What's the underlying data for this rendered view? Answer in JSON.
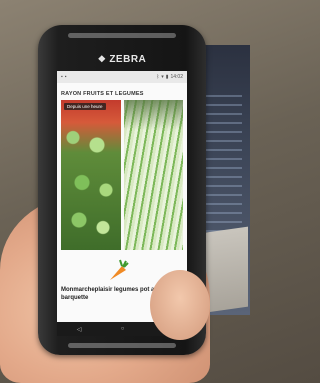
{
  "device": {
    "brand": "ZEBRA"
  },
  "status_bar": {
    "time": "14:02"
  },
  "app": {
    "section_title": "RAYON FRUITS ET LEGUMES",
    "photo_badge": "Depuis une heure",
    "product_name": "Monmarcheplaisir legumes pot au feu barquette"
  },
  "navigation": {
    "back": "◁",
    "home": "○",
    "recents": "□"
  }
}
